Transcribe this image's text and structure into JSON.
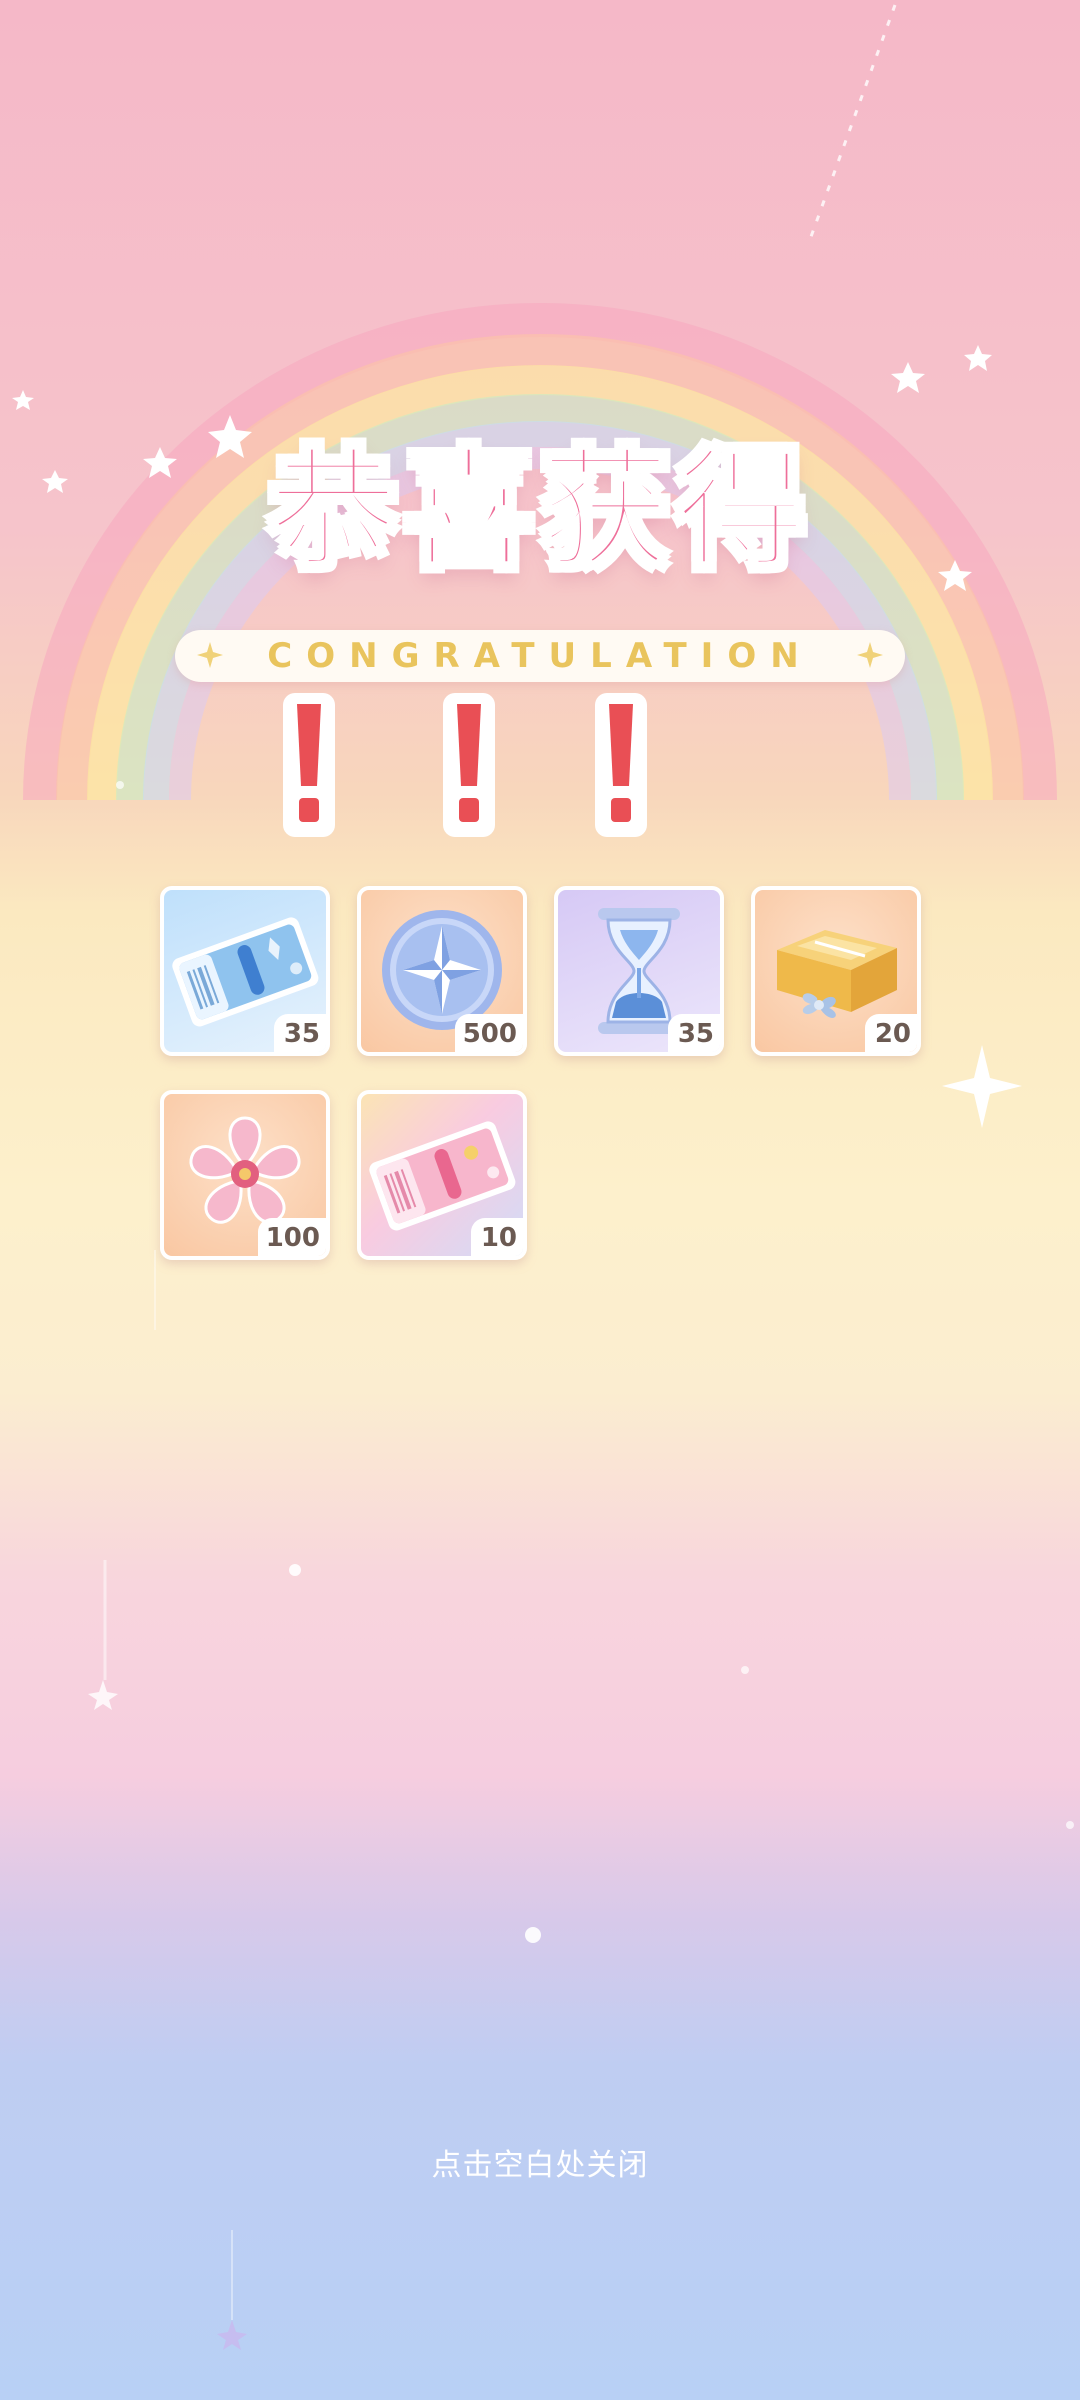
{
  "title": "恭喜获得",
  "subtitle": "CONGRATULATION",
  "exclamations": [
    "!",
    "!",
    "!"
  ],
  "items": [
    {
      "name": "blue-ticket",
      "icon": "blue-ticket-icon",
      "quantity": "35"
    },
    {
      "name": "star-coin",
      "icon": "star-coin-icon",
      "quantity": "500"
    },
    {
      "name": "hourglass",
      "icon": "hourglass-icon",
      "quantity": "35"
    },
    {
      "name": "gift-box",
      "icon": "gift-box-icon",
      "quantity": "20"
    },
    {
      "name": "sakura-flower",
      "icon": "sakura-flower-icon",
      "quantity": "100"
    },
    {
      "name": "pink-ticket",
      "icon": "pink-ticket-icon",
      "quantity": "10"
    }
  ],
  "close_hint": "点击空白处关闭",
  "colors": {
    "title_pink": "#ee6f9a",
    "subtitle_gold": "#e9c45d",
    "exclamation_red": "#e94f55",
    "qty_text": "#6b5a52"
  }
}
